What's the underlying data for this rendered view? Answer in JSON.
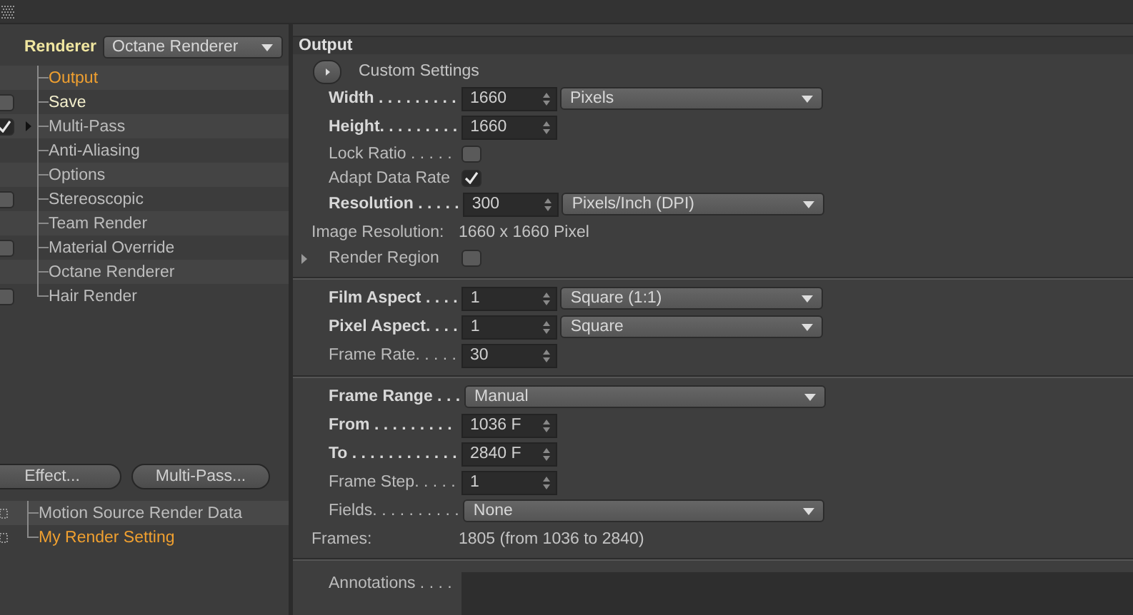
{
  "renderer": {
    "label": "Renderer",
    "value": "Octane Renderer"
  },
  "tree": [
    {
      "label": "Output",
      "selected": true,
      "modified": false
    },
    {
      "label": "Save",
      "selected": false,
      "modified": true,
      "checked": false
    },
    {
      "label": "Multi-Pass",
      "selected": false,
      "modified": false,
      "checked": true,
      "expandable": true
    },
    {
      "label": "Anti-Aliasing",
      "selected": false,
      "modified": false
    },
    {
      "label": "Options",
      "selected": false,
      "modified": false
    },
    {
      "label": "Stereoscopic",
      "selected": false,
      "modified": false,
      "checked": false
    },
    {
      "label": "Team Render",
      "selected": false,
      "modified": false
    },
    {
      "label": "Material Override",
      "selected": false,
      "modified": false,
      "checked": false
    },
    {
      "label": "Octane Renderer",
      "selected": false,
      "modified": false
    },
    {
      "label": "Hair Render",
      "selected": false,
      "modified": false,
      "checked": false
    }
  ],
  "buttons": [
    "Effect...",
    "Multi-Pass..."
  ],
  "render_settings": [
    {
      "label": "Motion Source Render Data",
      "selected": false
    },
    {
      "label": "My Render Setting",
      "selected": true
    }
  ],
  "panel": {
    "title": "Output",
    "sections": [
      {
        "rows": [
          {
            "kind": "button",
            "label": "Custom Settings"
          },
          {
            "kind": "number",
            "label": "Width . . . . . . . . .",
            "bold": true,
            "value": "1660",
            "unit": "Pixels"
          },
          {
            "kind": "number",
            "label": "Height. . . . . . . . .",
            "bold": true,
            "value": "1660"
          },
          {
            "kind": "checkbox",
            "label": "Lock Ratio . . . . .",
            "bold": false,
            "checked": false
          },
          {
            "kind": "checkbox",
            "label": "Adapt Data Rate",
            "bold": false,
            "checked": true
          },
          {
            "kind": "number",
            "label": "Resolution . . . . .",
            "bold": true,
            "value": "300",
            "unit": "Pixels/Inch (DPI)"
          },
          {
            "kind": "info",
            "label": "Image Resolution:",
            "value": "1660 x 1660 Pixel"
          },
          {
            "kind": "disclosure",
            "label": "Render Region",
            "checked": false
          }
        ]
      },
      {
        "rows": [
          {
            "kind": "number",
            "label": "Film Aspect . . . .",
            "bold": true,
            "value": "1",
            "unit": "Square (1:1)"
          },
          {
            "kind": "number",
            "label": "Pixel Aspect. . . .",
            "bold": true,
            "value": "1",
            "unit": "Square"
          },
          {
            "kind": "number",
            "label": "Frame Rate. . . . .",
            "bold": false,
            "value": "30"
          }
        ]
      },
      {
        "rows": [
          {
            "kind": "dropdown",
            "label": "Frame Range . . .",
            "bold": true,
            "value": "Manual"
          },
          {
            "kind": "number",
            "label": "From . . . . . . . . .",
            "bold": true,
            "value": "1036 F"
          },
          {
            "kind": "number",
            "label": "To . . . . . . . . . . . .",
            "bold": true,
            "value": "2840 F"
          },
          {
            "kind": "number",
            "label": "Frame Step. . . . .",
            "bold": false,
            "value": "1"
          },
          {
            "kind": "dropdown",
            "label": "Fields. . . . . . . . . .",
            "bold": false,
            "value": "None"
          },
          {
            "kind": "info",
            "label": "Frames:",
            "value": "1805 (from 1036 to 2840)"
          }
        ]
      },
      {
        "rows": [
          {
            "kind": "textarea",
            "label": "Annotations . . . ."
          }
        ]
      }
    ]
  }
}
